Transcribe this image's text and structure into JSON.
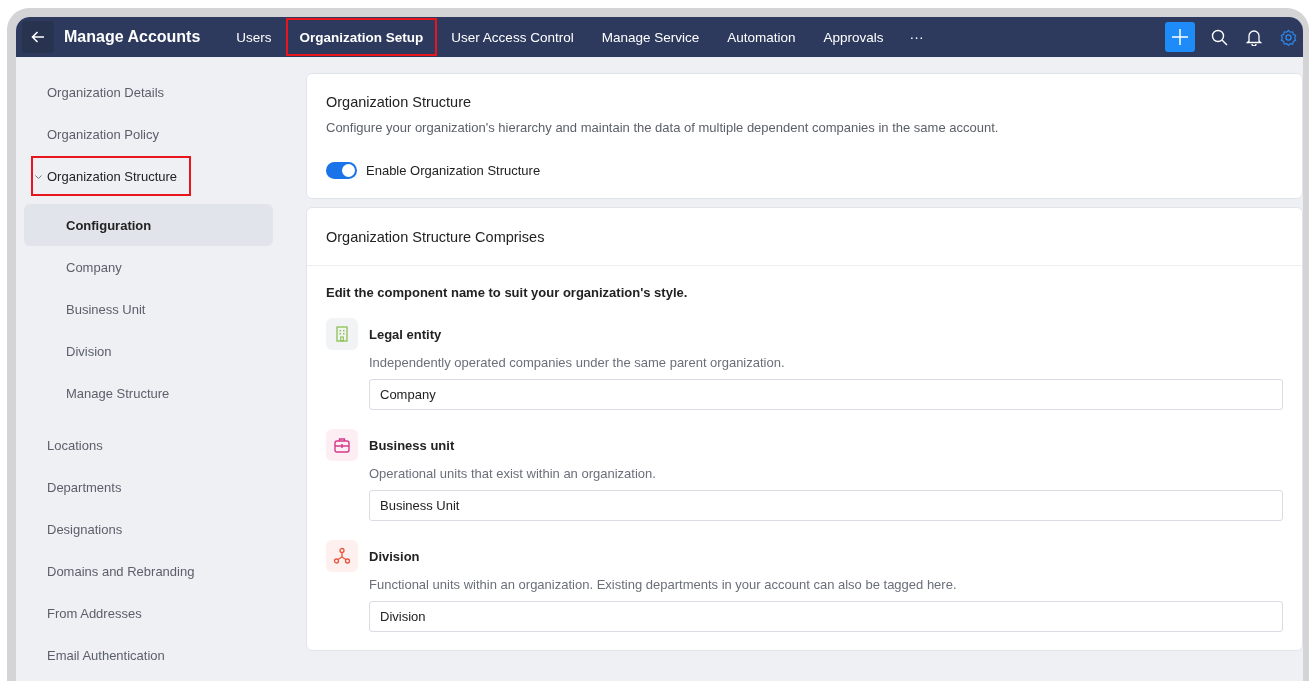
{
  "topbar": {
    "title": "Manage Accounts",
    "tabs": [
      {
        "label": "Users",
        "selected": false,
        "highlighted": false
      },
      {
        "label": "Organization Setup",
        "selected": true,
        "highlighted": true
      },
      {
        "label": "User Access Control",
        "selected": false,
        "highlighted": false
      },
      {
        "label": "Manage Service",
        "selected": false,
        "highlighted": false
      },
      {
        "label": "Automation",
        "selected": false,
        "highlighted": false
      },
      {
        "label": "Approvals",
        "selected": false,
        "highlighted": false
      }
    ],
    "more": "···"
  },
  "sidebar": {
    "items": [
      {
        "label": "Organization Details",
        "selected": false,
        "highlighted": false
      },
      {
        "label": "Organization Policy",
        "selected": false,
        "highlighted": false
      },
      {
        "label": "Organization Structure",
        "selected": false,
        "highlighted": true,
        "expanded": true,
        "children": [
          {
            "label": "Configuration",
            "selected": true
          },
          {
            "label": "Company",
            "selected": false
          },
          {
            "label": "Business Unit",
            "selected": false
          },
          {
            "label": "Division",
            "selected": false
          },
          {
            "label": "Manage Structure",
            "selected": false
          }
        ]
      },
      {
        "label": "Locations",
        "selected": false,
        "highlighted": false
      },
      {
        "label": "Departments",
        "selected": false,
        "highlighted": false
      },
      {
        "label": "Designations",
        "selected": false,
        "highlighted": false
      },
      {
        "label": "Domains and Rebranding",
        "selected": false,
        "highlighted": false
      },
      {
        "label": "From Addresses",
        "selected": false,
        "highlighted": false
      },
      {
        "label": "Email Authentication",
        "selected": false,
        "highlighted": false
      }
    ]
  },
  "structure_card": {
    "title": "Organization Structure",
    "description": "Configure your organization's hierarchy and maintain the data of multiple dependent companies in the same account.",
    "toggle": {
      "label": "Enable Organization Structure",
      "on": true
    }
  },
  "comprises_card": {
    "title": "Organization Structure Comprises",
    "instruction": "Edit the component name to suit your organization's style.",
    "components": [
      {
        "kind": "legal",
        "name": "Legal entity",
        "description": "Independently operated companies under the same parent organization.",
        "value": "Company"
      },
      {
        "kind": "business",
        "name": "Business unit",
        "description": "Operational units that exist within an organization.",
        "value": "Business Unit"
      },
      {
        "kind": "division",
        "name": "Division",
        "description": "Functional units within an organization. Existing departments in your account can also be tagged here.",
        "value": "Division"
      }
    ]
  }
}
